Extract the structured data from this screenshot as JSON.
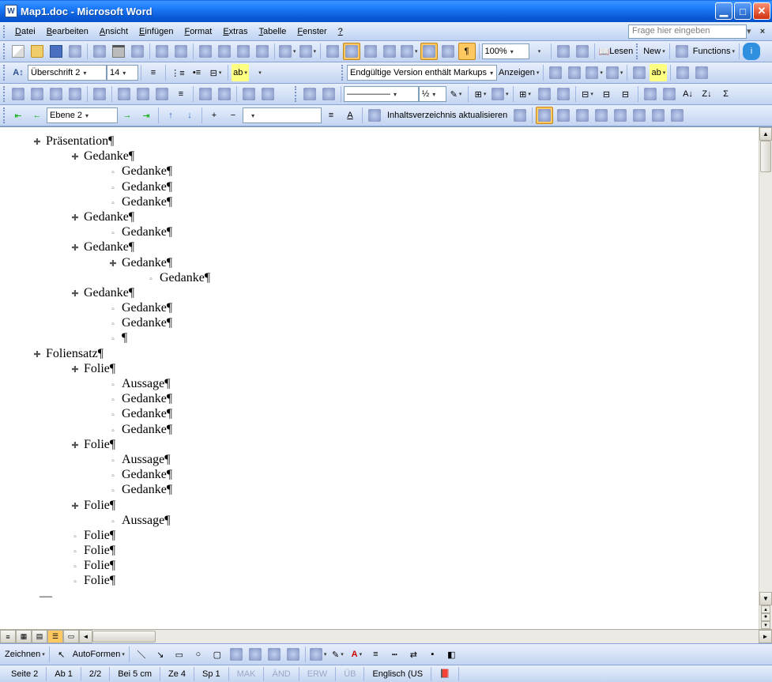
{
  "window": {
    "title": "Map1.doc - Microsoft Word",
    "app_icon": "W"
  },
  "menu": {
    "items": [
      {
        "label": "Datei",
        "accel": "D"
      },
      {
        "label": "Bearbeiten",
        "accel": "B"
      },
      {
        "label": "Ansicht",
        "accel": "A"
      },
      {
        "label": "Einfügen",
        "accel": "E"
      },
      {
        "label": "Format",
        "accel": "F"
      },
      {
        "label": "Extras",
        "accel": "E"
      },
      {
        "label": "Tabelle",
        "accel": "T"
      },
      {
        "label": "Fenster",
        "accel": "F"
      },
      {
        "label": "?",
        "accel": "?"
      }
    ],
    "ask_placeholder": "Frage hier eingeben"
  },
  "toolbar1": {
    "zoom": "100%",
    "read_label": "Lesen",
    "new_label": "New",
    "functions_label": "Functions"
  },
  "format_toolbar": {
    "style": "Überschrift 2",
    "font_size": "14",
    "review_mode": "Endgültige Version enthält Markups",
    "show_label": "Anzeigen"
  },
  "outline_toolbar": {
    "level": "Ebene 2",
    "toc_label": "Inhaltsverzeichnis aktualisieren",
    "line_weight": "½"
  },
  "document": {
    "outline": [
      {
        "indent": 0,
        "marker": "plus",
        "text": "Präsentation"
      },
      {
        "indent": 1,
        "marker": "plus",
        "text": "Gedanke"
      },
      {
        "indent": 2,
        "marker": "minus",
        "text": "Gedanke"
      },
      {
        "indent": 2,
        "marker": "minus",
        "text": "Gedanke"
      },
      {
        "indent": 2,
        "marker": "minus",
        "text": "Gedanke"
      },
      {
        "indent": 1,
        "marker": "plus",
        "text": "Gedanke"
      },
      {
        "indent": 2,
        "marker": "minus",
        "text": "Gedanke"
      },
      {
        "indent": 1,
        "marker": "plus",
        "text": "Gedanke"
      },
      {
        "indent": 2,
        "marker": "plus",
        "text": "Gedanke"
      },
      {
        "indent": 3,
        "marker": "minus",
        "text": "Gedanke"
      },
      {
        "indent": 1,
        "marker": "plus",
        "text": "Gedanke"
      },
      {
        "indent": 2,
        "marker": "minus",
        "text": "Gedanke"
      },
      {
        "indent": 2,
        "marker": "minus",
        "text": "Gedanke"
      },
      {
        "indent": 2,
        "marker": "minus",
        "text": ""
      },
      {
        "indent": 0,
        "marker": "plus",
        "text": "Foliensatz"
      },
      {
        "indent": 1,
        "marker": "plus",
        "text": "Folie"
      },
      {
        "indent": 2,
        "marker": "minus",
        "text": "Aussage"
      },
      {
        "indent": 2,
        "marker": "minus",
        "text": "Gedanke"
      },
      {
        "indent": 2,
        "marker": "minus",
        "text": "Gedanke"
      },
      {
        "indent": 2,
        "marker": "minus",
        "text": "Gedanke"
      },
      {
        "indent": 1,
        "marker": "plus",
        "text": "Folie"
      },
      {
        "indent": 2,
        "marker": "minus",
        "text": "Aussage"
      },
      {
        "indent": 2,
        "marker": "minus",
        "text": "Gedanke"
      },
      {
        "indent": 2,
        "marker": "minus",
        "text": "Gedanke"
      },
      {
        "indent": 1,
        "marker": "plus",
        "text": "Folie"
      },
      {
        "indent": 2,
        "marker": "minus",
        "text": "Aussage"
      },
      {
        "indent": 1,
        "marker": "minus",
        "text": "Folie"
      },
      {
        "indent": 1,
        "marker": "minus",
        "text": "Folie"
      },
      {
        "indent": 1,
        "marker": "minus",
        "text": "Folie"
      },
      {
        "indent": 1,
        "marker": "minus",
        "text": "Folie"
      }
    ],
    "cursor_mark": "—"
  },
  "draw_toolbar": {
    "draw_label": "Zeichnen",
    "autoshapes_label": "AutoFormen"
  },
  "statusbar": {
    "page": "Seite  2",
    "section": "Ab  1",
    "pages": "2/2",
    "position": "Bei  5 cm",
    "line": "Ze  4",
    "column": "Sp  1",
    "mak": "MAK",
    "and": "ÄND",
    "erw": "ERW",
    "ub": "ÜB",
    "lang": "Englisch (US"
  }
}
